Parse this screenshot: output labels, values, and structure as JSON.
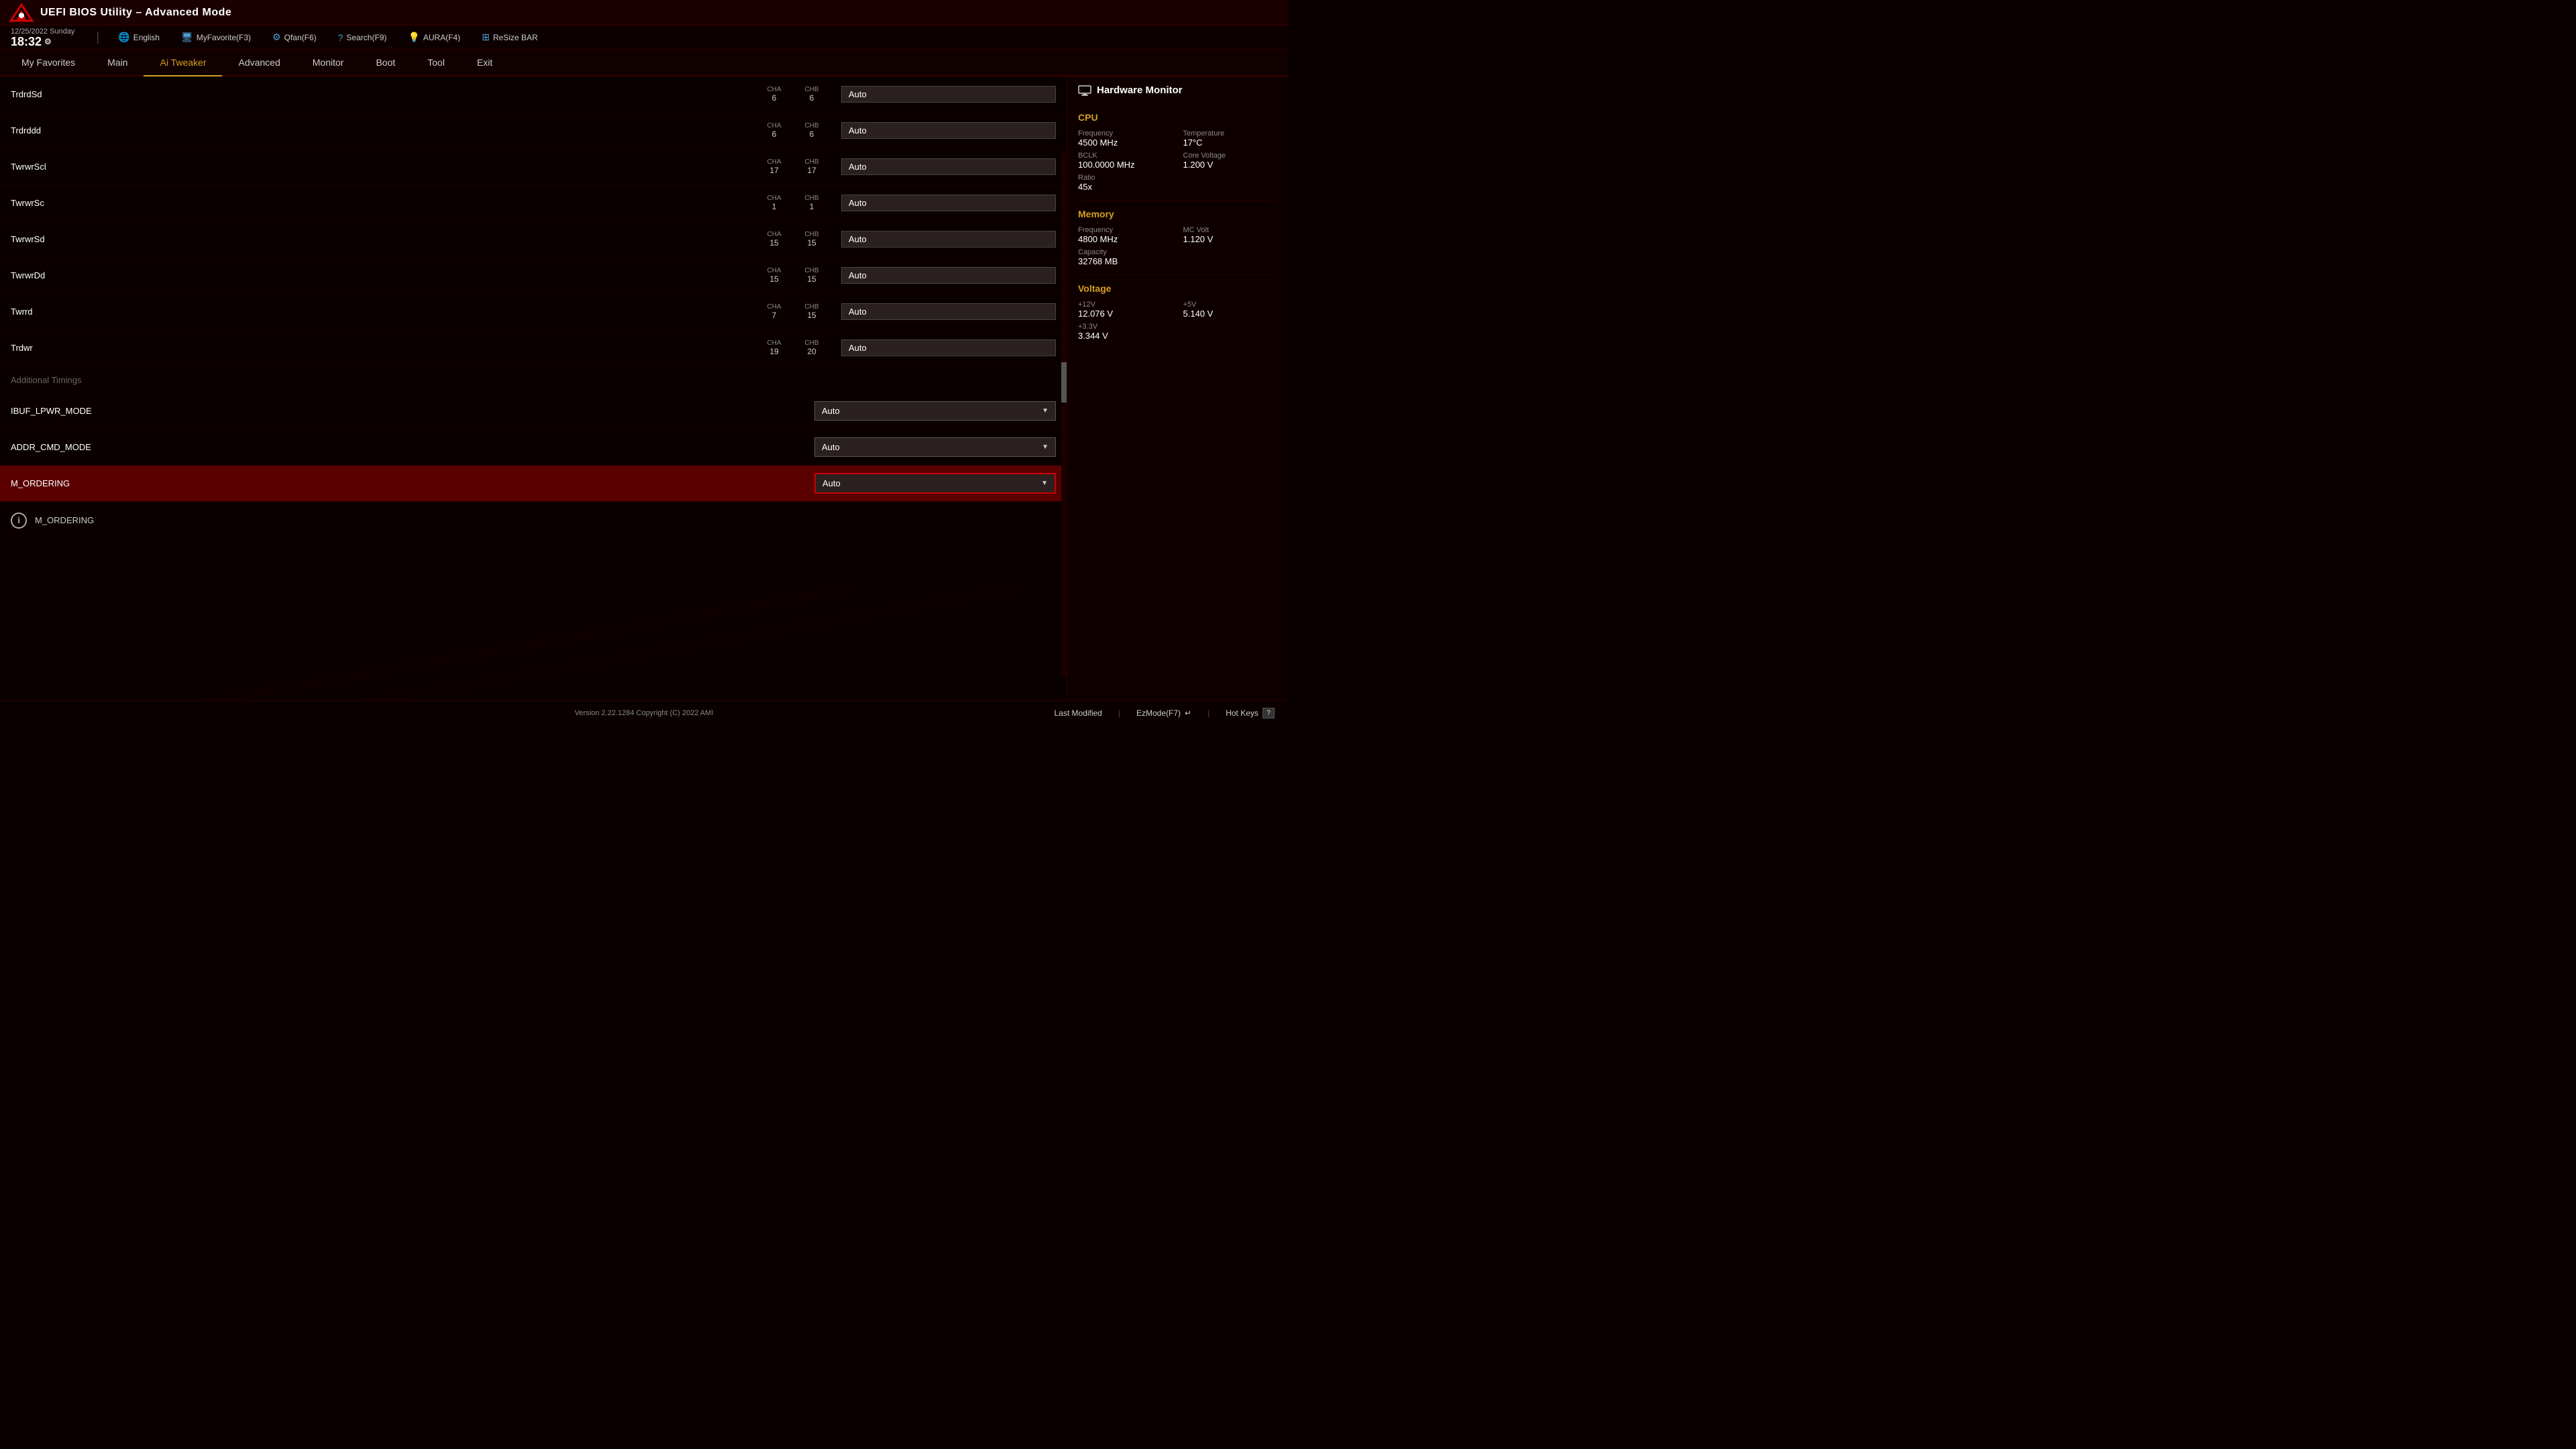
{
  "header": {
    "title": "UEFI BIOS Utility – Advanced Mode"
  },
  "toolbar": {
    "date": "12/25/2022",
    "day": "Sunday",
    "time": "18:32",
    "language": "English",
    "myfavorite": "MyFavorite(F3)",
    "qfan": "Qfan(F6)",
    "search": "Search(F9)",
    "aura": "AURA(F4)",
    "resize": "ReSize BAR"
  },
  "nav": {
    "items": [
      {
        "label": "My Favorites",
        "active": false
      },
      {
        "label": "Main",
        "active": false
      },
      {
        "label": "Ai Tweaker",
        "active": true
      },
      {
        "label": "Advanced",
        "active": false
      },
      {
        "label": "Monitor",
        "active": false
      },
      {
        "label": "Boot",
        "active": false
      },
      {
        "label": "Tool",
        "active": false
      },
      {
        "label": "Exit",
        "active": false
      }
    ]
  },
  "settings": [
    {
      "name": "TrdrdSd",
      "cha": "6",
      "chb": "6",
      "value": "Auto",
      "type": "text"
    },
    {
      "name": "Trdrddd",
      "cha": "6",
      "chb": "6",
      "value": "Auto",
      "type": "text"
    },
    {
      "name": "TwrwrScl",
      "cha": "17",
      "chb": "17",
      "value": "Auto",
      "type": "text"
    },
    {
      "name": "TwrwrSc",
      "cha": "1",
      "chb": "1",
      "value": "Auto",
      "type": "text"
    },
    {
      "name": "TwrwrSd",
      "cha": "15",
      "chb": "15",
      "value": "Auto",
      "type": "text"
    },
    {
      "name": "TwrwrDd",
      "cha": "15",
      "chb": "15",
      "value": "Auto",
      "type": "text"
    },
    {
      "name": "Twrrd",
      "cha": "7",
      "chb": "15",
      "value": "Auto",
      "type": "text"
    },
    {
      "name": "Trdwr",
      "cha": "19",
      "chb": "20",
      "value": "Auto",
      "type": "text"
    }
  ],
  "additional_timings": {
    "label": "Additional Timings",
    "rows": [
      {
        "name": "IBUF_LPWR_MODE",
        "value": "Auto",
        "type": "dropdown"
      },
      {
        "name": "ADDR_CMD_MODE",
        "value": "Auto",
        "type": "dropdown"
      },
      {
        "name": "M_ORDERING",
        "value": "Auto",
        "type": "dropdown",
        "highlighted": true
      }
    ]
  },
  "info": {
    "label": "M_ORDERING"
  },
  "hw_monitor": {
    "title": "Hardware Monitor",
    "cpu": {
      "section": "CPU",
      "frequency_label": "Frequency",
      "frequency_value": "4500 MHz",
      "temperature_label": "Temperature",
      "temperature_value": "17°C",
      "bclk_label": "BCLK",
      "bclk_value": "100.0000 MHz",
      "core_voltage_label": "Core Voltage",
      "core_voltage_value": "1.200 V",
      "ratio_label": "Ratio",
      "ratio_value": "45x"
    },
    "memory": {
      "section": "Memory",
      "frequency_label": "Frequency",
      "frequency_value": "4800 MHz",
      "mc_volt_label": "MC Volt",
      "mc_volt_value": "1.120 V",
      "capacity_label": "Capacity",
      "capacity_value": "32768 MB"
    },
    "voltage": {
      "section": "Voltage",
      "v12_label": "+12V",
      "v12_value": "12.076 V",
      "v5_label": "+5V",
      "v5_value": "5.140 V",
      "v33_label": "+3.3V",
      "v33_value": "3.344 V"
    }
  },
  "bottom": {
    "version": "Version 2.22.1284 Copyright (C) 2022 AMI",
    "last_modified": "Last Modified",
    "ezmode": "EzMode(F7)",
    "hotkeys": "Hot Keys"
  },
  "colors": {
    "accent_gold": "#d4a020",
    "accent_red": "#cc0000",
    "text_white": "#ffffff",
    "text_gray": "#888888"
  }
}
